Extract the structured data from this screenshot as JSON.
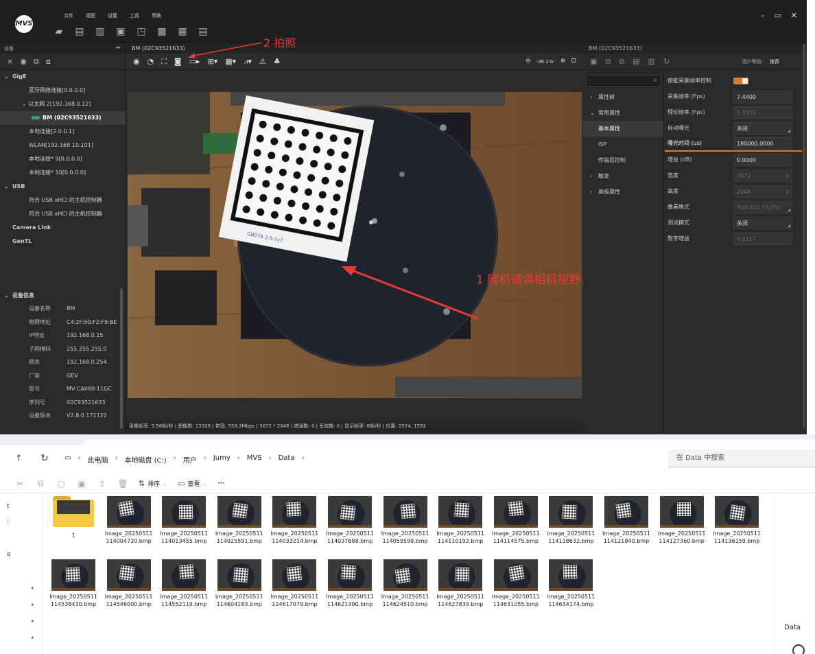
{
  "mvs": {
    "logo": "MVS",
    "menu": [
      "文件",
      "视图",
      "设置",
      "工具",
      "帮助"
    ],
    "window_controls": [
      "–",
      "▭",
      "✕"
    ],
    "left": {
      "header": "设备",
      "tree": {
        "gige": "GigE",
        "bt": "蓝牙网络连接[0.0.0.0]",
        "eth2": "以太网 2[192.168.0.12]",
        "cam": "BM (02C93521633)",
        "local": "本地连接[2.0.0.1]",
        "wlan": "WLAN[192.168.10.101]",
        "local9": "本地连接* 9[0.0.0.0]",
        "local10": "本地连接* 10[0.0.0.0]",
        "usb": "USB",
        "usb1": "符合 USB xHCI 的主机控制器",
        "usb2": "符合 USB xHCI 的主机控制器",
        "cameralink": "Camera Link",
        "gentl": "GenTL"
      },
      "devinfo_title": "设备信息",
      "devinfo": [
        {
          "k": "设备名称",
          "v": "BM"
        },
        {
          "k": "物理地址",
          "v": "C4:2F:90:F2:F9:BE"
        },
        {
          "k": "IP地址",
          "v": "192.168.0.15"
        },
        {
          "k": "子网掩码",
          "v": "255.255.255.0"
        },
        {
          "k": "网关",
          "v": "192.168.0.254"
        },
        {
          "k": "厂商",
          "v": "GEV"
        },
        {
          "k": "型号",
          "v": "MV-CA060-11GC"
        },
        {
          "k": "序列号",
          "v": "02C93521633"
        },
        {
          "k": "设备版本",
          "v": "V2.8.0 171122"
        }
      ]
    },
    "center": {
      "title": "BM (02C93521633)",
      "zoom": "-36.1%-",
      "status": "采集帧率: 5.56帧/秒 | 图像数: 13326 | 带宽: 559.2Mbps | 3072 * 2048 | 错误数: 0 | 丢包数: 0 | 显示帧率: 6帧/秒 | 位置: 2574, 1592",
      "board_text": "GB079-3.5-7x7"
    },
    "annotations": {
      "photo": "2 拍照",
      "coverage": "1 随机铺满相机视野，拍摄20张以上图像"
    },
    "right": {
      "title": "BM (02C93521633)",
      "user_level_label": "用户等级:",
      "user_level": "推荐",
      "categories": {
        "attr_tree": "属性树",
        "common": "常用属性",
        "basic": "基本属性",
        "isp": "ISP",
        "transport": "传输层控制",
        "trigger": "触发",
        "advanced": "高级属性"
      },
      "props": [
        {
          "k": "使能采集帧率控制",
          "v": ""
        },
        {
          "k": "采集帧率 (Fps)",
          "v": "7.4400"
        },
        {
          "k": "理论帧率 (Fps)",
          "v": "5.5555"
        },
        {
          "k": "自动曝光",
          "v": "关闭"
        },
        {
          "k": "曝光时间 (us)",
          "v": "180000.0000"
        },
        {
          "k": "增益 (dB)",
          "v": "0.0000"
        },
        {
          "k": "宽度",
          "v": "3072"
        },
        {
          "k": "高度",
          "v": "2048"
        },
        {
          "k": "像素格式",
          "v": "YUV 422 (YUYV)"
        },
        {
          "k": "测试模式",
          "v": "关闭"
        },
        {
          "k": "数字增益",
          "v": "0.0117"
        }
      ]
    }
  },
  "explorer": {
    "crumbs": [
      "此电脑",
      "本地磁盘 (C:)",
      "用户",
      "Jumy",
      "MVS",
      "Data"
    ],
    "search_placeholder": "在 Data 中搜索",
    "sort_label": "排序",
    "view_label": "查看",
    "more": "···",
    "folder_name": "1",
    "files": [
      "Image_20250511114004720.bmp",
      "Image_20250511114013455.bmp",
      "Image_20250511114025591.bmp",
      "Image_20250511114033214.bmp",
      "Image_20250511114037688.bmp",
      "Image_20250511114059599.bmp",
      "Image_20250511114110192.bmp",
      "Image_20250511114114575.bmp",
      "Image_20250511114118632.bmp",
      "Image_20250511114121840.bmp",
      "Image_20250511114127360.bmp",
      "Image_20250511114136159.bmp",
      "Image_20250511114538430.bmp",
      "Image_20250511114546000.bmp",
      "Image_20250511114552119.bmp",
      "Image_20250511114604183.bmp",
      "Image_20250511114617079.bmp",
      "Image_20250511114621390.bmp",
      "Image_20250511114624510.bmp",
      "Image_20250511114627839.bmp",
      "Image_20250511114631055.bmp",
      "Image_20250511114634174.bmp"
    ],
    "details_label": "Data"
  },
  "colors": {
    "accent": "#e07a2a",
    "annotation": "#e53b3b",
    "folder": "#f7c744"
  }
}
